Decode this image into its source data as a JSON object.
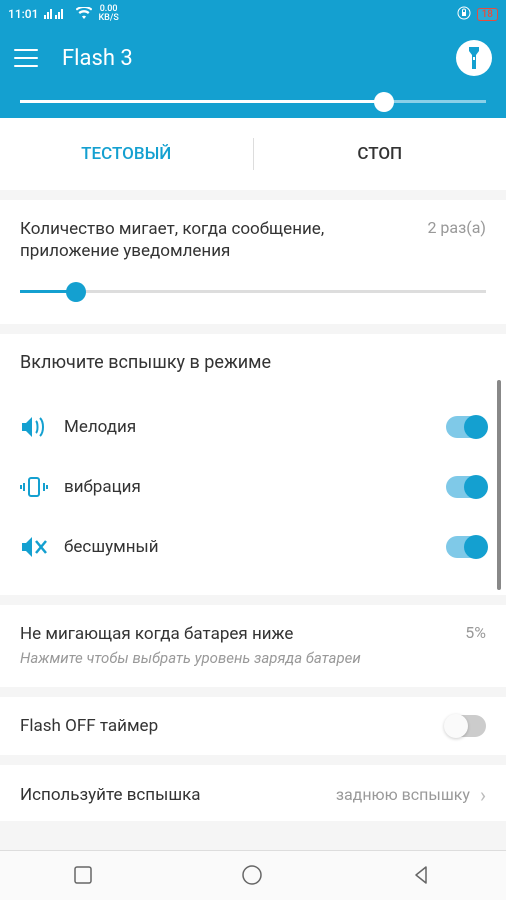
{
  "status": {
    "time": "11:01",
    "data_rate": "0.00",
    "data_unit": "KB/S",
    "battery": "18"
  },
  "header": {
    "title": "Flash 3"
  },
  "tabs": {
    "test": "ТЕСТОВЫЙ",
    "stop": "СТОП"
  },
  "blink_count": {
    "label": "Количество мигает, когда сообщение, приложение уведомления",
    "value": "2 раз(a)",
    "slider_percent": 12
  },
  "flash_mode": {
    "heading": "Включите вспышку в режиме",
    "items": [
      {
        "label": "Мелодия",
        "icon": "sound",
        "on": true
      },
      {
        "label": "вибрация",
        "icon": "vibrate",
        "on": true
      },
      {
        "label": "бесшумный",
        "icon": "mute",
        "on": true
      }
    ]
  },
  "battery_section": {
    "title": "Не мигающая когда батарея ниже",
    "subtitle": "Нажмите чтобы выбрать уровень заряда батареи",
    "value": "5%"
  },
  "timer": {
    "label": "Flash OFF таймер",
    "on": false
  },
  "use_flash": {
    "label": "Используйте вспышка",
    "value": "заднюю вспышку"
  }
}
